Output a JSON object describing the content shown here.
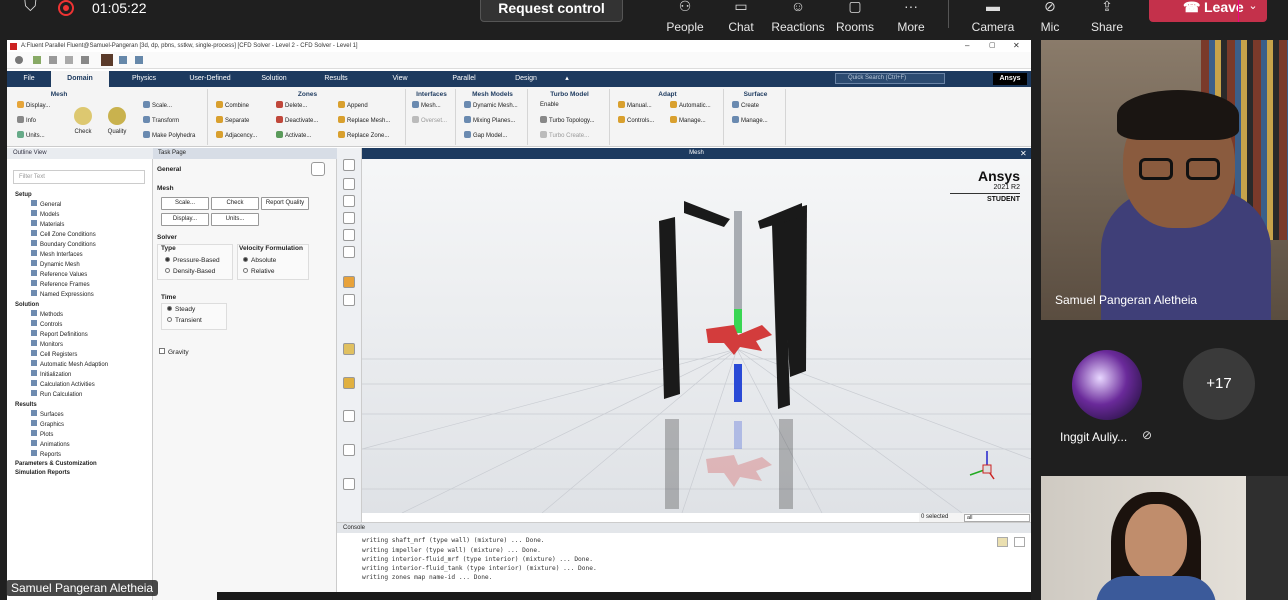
{
  "teams": {
    "timer": "01:05:22",
    "request_control": "Request control",
    "buttons": [
      "People",
      "Chat",
      "Reactions",
      "Rooms",
      "More",
      "Camera",
      "Mic",
      "Share"
    ],
    "leave": "Leave"
  },
  "fluent": {
    "window_title": "A:Fluent Parallel Fluent@Samuel-Pangeran  [3d, dp, pbns, sstkw, single-process] [CFD Solver - Level 2 - CFD Solver - Level 1]",
    "tabs": [
      "File",
      "Domain",
      "Physics",
      "User-Defined",
      "Solution",
      "Results",
      "View",
      "Parallel",
      "Design"
    ],
    "quick_search": "Quick Search (Ctrl+F)",
    "ansys_tab": "Ansys",
    "ribbon": {
      "mesh": {
        "header": "Mesh",
        "items": [
          "Display...",
          "Info",
          "Units...",
          "Check",
          "Quality"
        ]
      },
      "zones": {
        "header": "Zones",
        "items": [
          "Scale...",
          "Transform",
          "Make Polyhedra",
          "Combine",
          "Separate",
          "Adjacency...",
          "Delete...",
          "Deactivate...",
          "Activate...",
          "Append",
          "Replace Mesh...",
          "Replace Zone..."
        ]
      },
      "interfaces": {
        "header": "Interfaces",
        "items": [
          "Mesh...",
          "Overset..."
        ]
      },
      "mesh_models": {
        "header": "Mesh Models",
        "items": [
          "Dynamic Mesh...",
          "Mixing Planes...",
          "Gap Model..."
        ]
      },
      "turbo": {
        "header": "Turbo Model",
        "items": [
          "Enable",
          "Turbo Topology...",
          "Turbo Create..."
        ]
      },
      "adapt": {
        "header": "Adapt",
        "items": [
          "Manual...",
          "Automatic...",
          "Controls...",
          "Manage..."
        ]
      },
      "surface": {
        "header": "Surface",
        "items": [
          "Create",
          "Manage..."
        ]
      }
    },
    "outline": {
      "title": "Outline View",
      "filter": "Filter Text",
      "items": [
        "Setup",
        "General",
        "Models",
        "Materials",
        "Cell Zone Conditions",
        "Boundary Conditions",
        "Mesh Interfaces",
        "Dynamic Mesh",
        "Reference Values",
        "Reference Frames",
        "Named Expressions",
        "Solution",
        "Methods",
        "Controls",
        "Report Definitions",
        "Monitors",
        "Cell Registers",
        "Automatic Mesh Adaption",
        "Initialization",
        "Calculation Activities",
        "Run Calculation",
        "Results",
        "Surfaces",
        "Graphics",
        "Plots",
        "Animations",
        "Reports",
        "Parameters & Customization",
        "Simulation Reports"
      ]
    },
    "task": {
      "title": "Task Page",
      "section": "General",
      "mesh_label": "Mesh",
      "mesh_buttons": [
        "Scale...",
        "Check",
        "Report Quality",
        "Display...",
        "Units..."
      ],
      "solver_label": "Solver",
      "type_label": "Type",
      "types": [
        "Pressure-Based",
        "Density-Based"
      ],
      "velocity_label": "Velocity Formulation",
      "velocities": [
        "Absolute",
        "Relative"
      ],
      "time_label": "Time",
      "times": [
        "Steady",
        "Transient"
      ],
      "gravity": "Gravity"
    },
    "graphics": {
      "title": "Mesh",
      "brand": "Ansys",
      "version": "2021 R2",
      "edition": "STUDENT",
      "selected": "0 selected",
      "filter": "all"
    },
    "console": {
      "title": "Console",
      "lines": [
        "writing shaft_mrf (type wall) (mixture) ... Done.",
        "writing impeller (type wall) (mixture) ... Done.",
        "writing interior-fluid_mrf (type interior) (mixture) ... Done.",
        "writing interior-fluid_tank (type interior) (mixture) ... Done.",
        "writing zones map name-id ... Done."
      ]
    }
  },
  "participants": {
    "speaker": "Samuel Pangeran Aletheia",
    "second": "Inggit Auliy...",
    "more_count": "+17",
    "presenter_tag": "Samuel Pangeran Aletheia"
  }
}
